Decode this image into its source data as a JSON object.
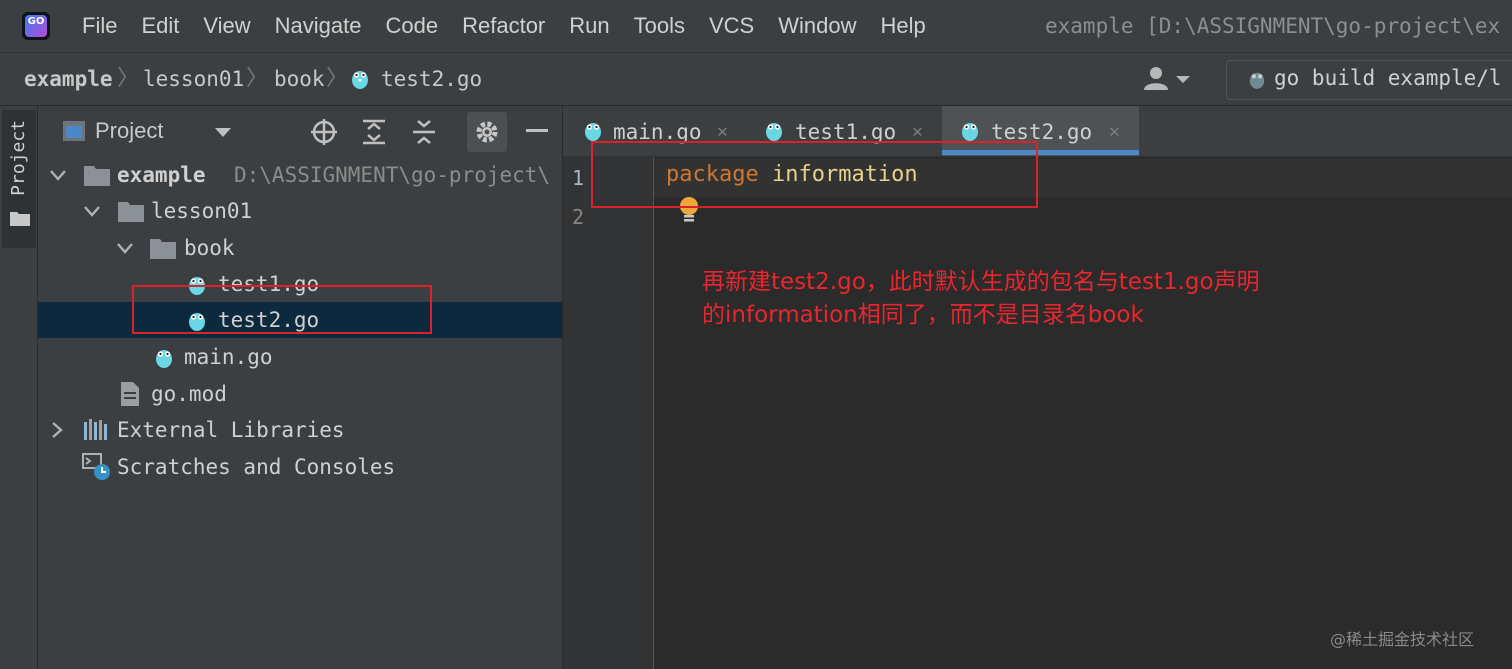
{
  "menu": {
    "items": [
      "File",
      "Edit",
      "View",
      "Navigate",
      "Code",
      "Refactor",
      "Run",
      "Tools",
      "VCS",
      "Window",
      "Help"
    ],
    "window_title": "example [D:\\ASSIGNMENT\\go-project\\ex"
  },
  "logo": {
    "text": "GO"
  },
  "breadcrumbs": [
    "example",
    "lesson01",
    "book",
    "test2.go"
  ],
  "run_config": {
    "label": "go build example/l"
  },
  "tool_strip": {
    "project_label": "Project"
  },
  "project_panel": {
    "title": "Project",
    "tree": [
      {
        "label": "example",
        "path": "D:\\ASSIGNMENT\\go-project\\"
      },
      {
        "label": "lesson01"
      },
      {
        "label": "book"
      },
      {
        "label": "test1.go"
      },
      {
        "label": "test2.go"
      },
      {
        "label": "main.go"
      },
      {
        "label": "go.mod"
      },
      {
        "label": "External Libraries"
      },
      {
        "label": "Scratches and Consoles"
      }
    ]
  },
  "tabs": [
    {
      "label": "main.go"
    },
    {
      "label": "test1.go"
    },
    {
      "label": "test2.go",
      "active": true
    }
  ],
  "editor": {
    "line_numbers": [
      "1",
      "2"
    ],
    "code_keyword": "package",
    "code_name": "information"
  },
  "annotation": {
    "line1": "再新建test2.go，此时默认生成的包名与test1.go声明",
    "line2": "的information相同了，而不是目录名book"
  },
  "watermark": "@稀土掘金技术社区",
  "colors": {
    "accent": "#4a88c7",
    "annotation_red": "#e8262d",
    "selection": "#0d293e",
    "keyword": "#cc7832"
  }
}
